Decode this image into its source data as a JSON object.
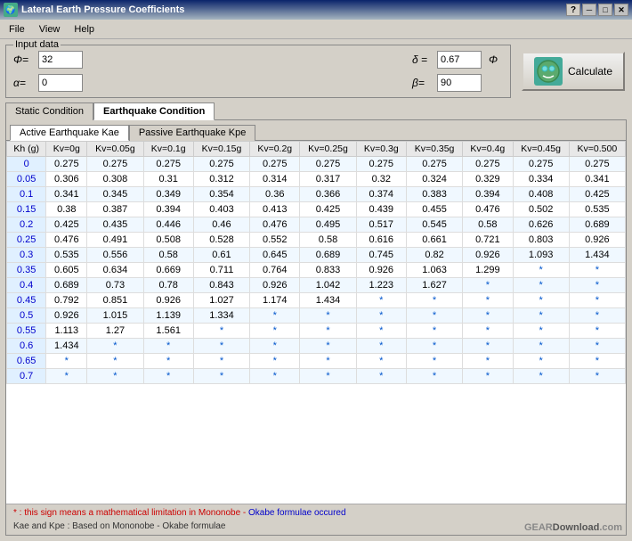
{
  "titleBar": {
    "title": "Lateral Earth Pressure Coefficients",
    "helpBtn": "?",
    "closeBtn": "✕",
    "minBtn": "─",
    "maxBtn": "□"
  },
  "menu": {
    "items": [
      "File",
      "View",
      "Help"
    ]
  },
  "inputGroup": {
    "legend": "Input data",
    "phi": {
      "label": "Φ=",
      "value": "32"
    },
    "alpha": {
      "label": "α=",
      "value": "0"
    },
    "delta": {
      "label": "δ =",
      "value": "0.67",
      "symbol": "Φ"
    },
    "beta": {
      "label": "β=",
      "value": "90"
    }
  },
  "calcButton": {
    "label": "Calculate",
    "icon": "🔧"
  },
  "outerTabs": [
    {
      "label": "Static Condition",
      "active": false
    },
    {
      "label": "Earthquake Condition",
      "active": true
    }
  ],
  "innerTabs": [
    {
      "label": "Active Earthquake Kae",
      "active": true
    },
    {
      "label": "Passive Earthquake Kpe",
      "active": false
    }
  ],
  "tableHeaders": [
    "Kh (g)",
    "Kv=0g",
    "Kv=0.05g",
    "Kv=0.1g",
    "Kv=0.15g",
    "Kv=0.2g",
    "Kv=0.25g",
    "Kv=0.3g",
    "Kv=0.35g",
    "Kv=0.4g",
    "Kv=0.45g",
    "Kv=0.500"
  ],
  "tableRows": [
    [
      "0",
      "0.275",
      "0.275",
      "0.275",
      "0.275",
      "0.275",
      "0.275",
      "0.275",
      "0.275",
      "0.275",
      "0.275",
      "0.275"
    ],
    [
      "0.05",
      "0.306",
      "0.308",
      "0.31",
      "0.312",
      "0.314",
      "0.317",
      "0.32",
      "0.324",
      "0.329",
      "0.334",
      "0.341"
    ],
    [
      "0.1",
      "0.341",
      "0.345",
      "0.349",
      "0.354",
      "0.36",
      "0.366",
      "0.374",
      "0.383",
      "0.394",
      "0.408",
      "0.425"
    ],
    [
      "0.15",
      "0.38",
      "0.387",
      "0.394",
      "0.403",
      "0.413",
      "0.425",
      "0.439",
      "0.455",
      "0.476",
      "0.502",
      "0.535"
    ],
    [
      "0.2",
      "0.425",
      "0.435",
      "0.446",
      "0.46",
      "0.476",
      "0.495",
      "0.517",
      "0.545",
      "0.58",
      "0.626",
      "0.689"
    ],
    [
      "0.25",
      "0.476",
      "0.491",
      "0.508",
      "0.528",
      "0.552",
      "0.58",
      "0.616",
      "0.661",
      "0.721",
      "0.803",
      "0.926"
    ],
    [
      "0.3",
      "0.535",
      "0.556",
      "0.58",
      "0.61",
      "0.645",
      "0.689",
      "0.745",
      "0.82",
      "0.926",
      "1.093",
      "1.434"
    ],
    [
      "0.35",
      "0.605",
      "0.634",
      "0.669",
      "0.711",
      "0.764",
      "0.833",
      "0.926",
      "1.063",
      "1.299",
      "*",
      "*"
    ],
    [
      "0.4",
      "0.689",
      "0.73",
      "0.78",
      "0.843",
      "0.926",
      "1.042",
      "1.223",
      "1.627",
      "*",
      "*",
      "*"
    ],
    [
      "0.45",
      "0.792",
      "0.851",
      "0.926",
      "1.027",
      "1.174",
      "1.434",
      "*",
      "*",
      "*",
      "*",
      "*"
    ],
    [
      "0.5",
      "0.926",
      "1.015",
      "1.139",
      "1.334",
      "*",
      "*",
      "*",
      "*",
      "*",
      "*",
      "*"
    ],
    [
      "0.55",
      "1.113",
      "1.27",
      "1.561",
      "*",
      "*",
      "*",
      "*",
      "*",
      "*",
      "*",
      "*"
    ],
    [
      "0.6",
      "1.434",
      "*",
      "*",
      "*",
      "*",
      "*",
      "*",
      "*",
      "*",
      "*",
      "*"
    ],
    [
      "0.65",
      "*",
      "*",
      "*",
      "*",
      "*",
      "*",
      "*",
      "*",
      "*",
      "*",
      "*"
    ],
    [
      "0.7",
      "*",
      "*",
      "*",
      "*",
      "*",
      "*",
      "*",
      "*",
      "*",
      "*",
      "*"
    ]
  ],
  "footer": {
    "starNote": "* : this sign means a mathematical limitation in Mononobe - Okabe formulae occured",
    "kaeNote": "Kae and Kpe : Based on Mononobe - Okabe formulae",
    "brand": "GearDownload.com"
  }
}
